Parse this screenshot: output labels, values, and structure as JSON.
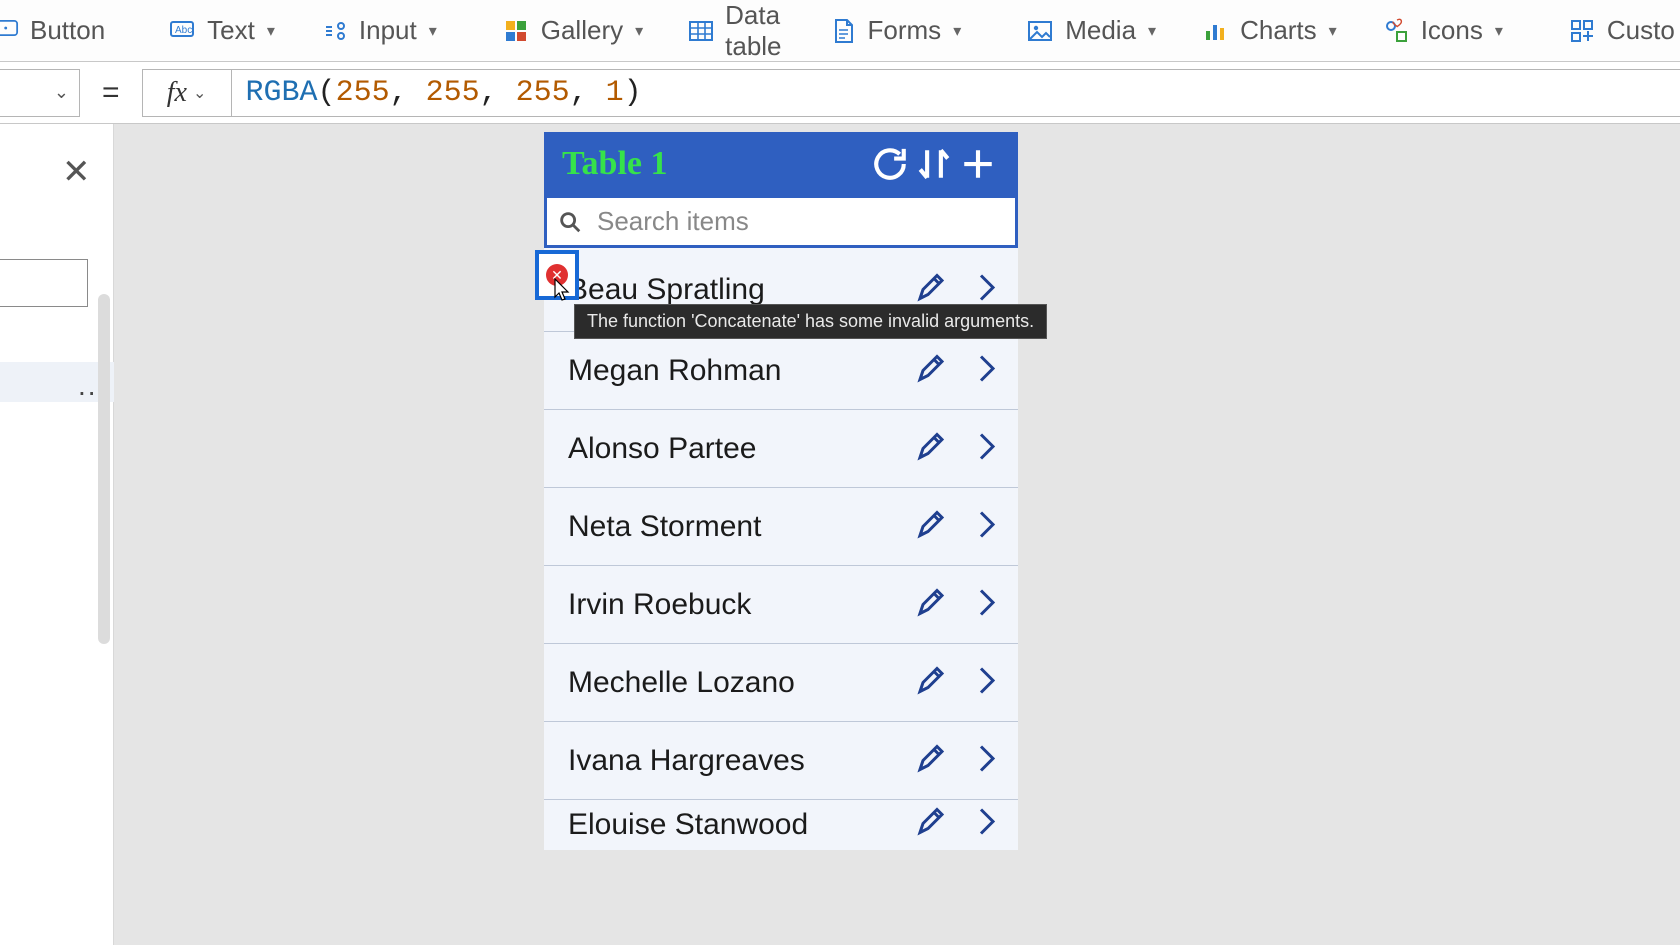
{
  "ribbon": {
    "leading_label": "Button",
    "items": [
      {
        "label": "Text",
        "icon": "text-icon",
        "dropdown": true
      },
      {
        "label": "Input",
        "icon": "input-icon",
        "dropdown": true
      },
      {
        "label": "Gallery",
        "icon": "gallery-icon",
        "dropdown": true
      },
      {
        "label": "Data table",
        "icon": "datatable-icon",
        "dropdown": false
      },
      {
        "label": "Forms",
        "icon": "forms-icon",
        "dropdown": true
      },
      {
        "label": "Media",
        "icon": "media-icon",
        "dropdown": true
      },
      {
        "label": "Charts",
        "icon": "charts-icon",
        "dropdown": true
      },
      {
        "label": "Icons",
        "icon": "icons-icon",
        "dropdown": true
      },
      {
        "label": "Custo",
        "icon": "custom-icon",
        "dropdown": false
      }
    ]
  },
  "formula": {
    "fn": "RGBA",
    "args": [
      "255",
      "255",
      "255",
      "1"
    ]
  },
  "tree": {
    "dots": "..."
  },
  "app": {
    "title": "Table 1",
    "search_placeholder": "Search items",
    "rows": [
      "Beau Spratling",
      "Megan Rohman",
      "Alonso Partee",
      "Neta Storment",
      "Irvin Roebuck",
      "Mechelle Lozano",
      "Ivana Hargreaves",
      "Elouise Stanwood"
    ],
    "error_tooltip": "The function 'Concatenate' has some invalid arguments."
  }
}
